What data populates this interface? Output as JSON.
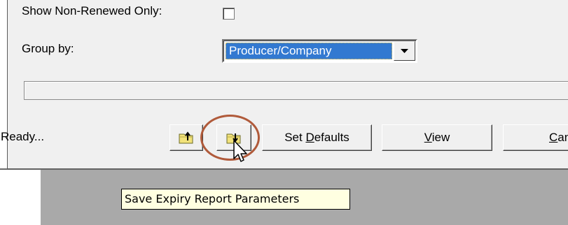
{
  "form": {
    "show_non_renewed_label": "Show Non-Renewed Only:",
    "show_non_renewed_checked": false,
    "group_by_label": "Group by:",
    "group_by_value": "Producer/Company"
  },
  "footer": {
    "status": "Ready...",
    "load_icon": "folder-up-icon",
    "save_icon": "folder-down-icon",
    "set_defaults_label": "Set Defaults",
    "view_label": "View",
    "cancel_label": "Can"
  },
  "tooltip": {
    "text": "Save Expiry Report Parameters"
  }
}
